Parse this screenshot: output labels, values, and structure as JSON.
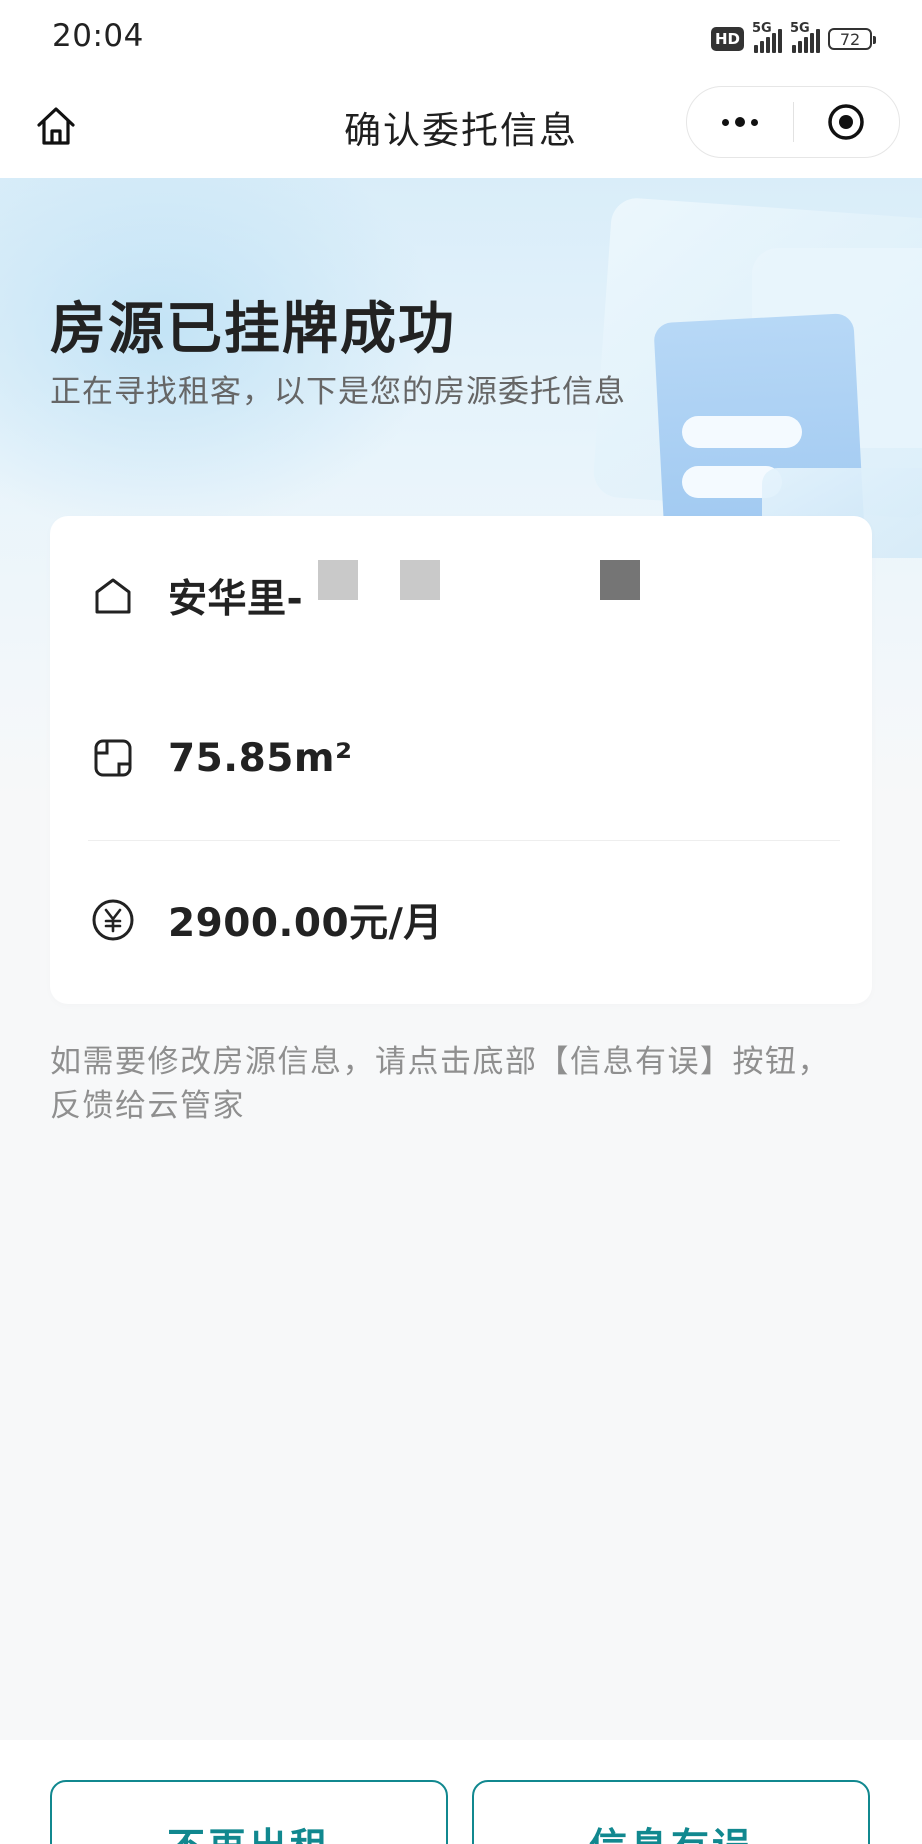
{
  "status_bar": {
    "time": "20:04",
    "hd_badge": "HD",
    "signal_1": "5G",
    "signal_2": "5G",
    "battery": "72"
  },
  "nav": {
    "title": "确认委托信息",
    "home_icon": "home-icon",
    "more_icon": "more-dots-icon",
    "close_icon": "target-close-icon"
  },
  "hero": {
    "title": "房源已挂牌成功",
    "subtitle": "正在寻找租客，以下是您的房源委托信息"
  },
  "info": {
    "address": "安华里-",
    "area": "75.85m²",
    "rent": "2900.00元/月",
    "address_icon": "house-icon",
    "area_icon": "area-icon",
    "rent_icon": "yuan-icon"
  },
  "note": "如需要修改房源信息，请点击底部【信息有误】按钮，反馈给云管家",
  "actions": {
    "stop_label": "不再出租",
    "error_label": "信息有误"
  },
  "colors": {
    "accent": "#11888f",
    "text_primary": "#222222",
    "text_secondary": "#8f8f8f"
  }
}
